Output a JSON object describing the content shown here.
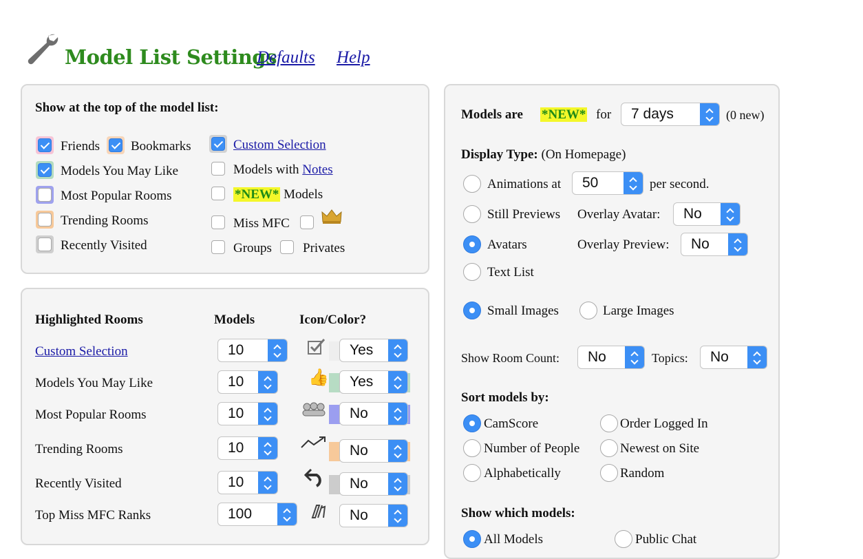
{
  "header": {
    "title": "Model List Settings",
    "defaults_link": "Defaults",
    "help_link": "Help"
  },
  "show_top": {
    "heading": "Show at the top of the model list:",
    "items": [
      {
        "label": "Friends",
        "checked": true
      },
      {
        "label": "Bookmarks",
        "checked": true
      },
      {
        "label": "Custom Selection",
        "checked": true
      },
      {
        "label": "Models You May Like",
        "checked": true
      },
      {
        "label": "Models with",
        "link": "Notes",
        "checked": false
      },
      {
        "label": "Most Popular Rooms",
        "checked": false
      },
      {
        "new_tag": "*NEW*",
        "label": "Models",
        "checked": false
      },
      {
        "label": "Trending Rooms",
        "checked": false
      },
      {
        "label": "Miss MFC",
        "checked": false
      },
      {
        "label": "Recently Visited",
        "checked": false
      },
      {
        "label": "Groups",
        "checked": false
      },
      {
        "label": "Privates",
        "checked": false
      }
    ]
  },
  "highlighted": {
    "heading": "Highlighted Rooms",
    "col_models": "Models",
    "col_icon": "Icon/Color?",
    "rows": [
      {
        "label": "Custom Selection",
        "models": "10",
        "icon": "checkbox-icon",
        "color": "#eeeeee",
        "value": "Yes"
      },
      {
        "label": "Models You May Like",
        "models": "10",
        "icon": "thumbs-up-icon",
        "color": "#b7dcc4",
        "value": "Yes"
      },
      {
        "label": "Most Popular Rooms",
        "models": "10",
        "icon": "crowd-icon",
        "color": "#9b9ef0",
        "value": "No"
      },
      {
        "label": "Trending Rooms",
        "models": "10",
        "icon": "trending-icon",
        "color": "#f7c99a",
        "value": "No"
      },
      {
        "label": "Recently Visited",
        "models": "10",
        "icon": "undo-arrow-icon",
        "color": "#cccccc",
        "value": "No"
      },
      {
        "label": "Top Miss MFC Ranks",
        "models": "100",
        "icon": "rank-icon",
        "color": "",
        "value": "No"
      }
    ]
  },
  "right": {
    "models_are": "Models are",
    "new_tag": "*NEW*",
    "for": "for",
    "new_period": "7 days",
    "new_count": "(0 new)",
    "display_type": "Display Type:",
    "display_hint": "(On Homepage)",
    "animations_label": "Animations at",
    "animations_rate": "50",
    "per_second": "per second.",
    "still_previews": "Still Previews",
    "overlay_avatar": "Overlay Avatar:",
    "overlay_avatar_val": "No",
    "avatars": "Avatars",
    "overlay_preview": "Overlay Preview:",
    "overlay_preview_val": "No",
    "text_list": "Text List",
    "small_images": "Small Images",
    "large_images": "Large Images",
    "show_room_count": "Show Room Count:",
    "room_count_val": "No",
    "topics": "Topics:",
    "topics_val": "No",
    "sort_heading": "Sort models by:",
    "sort": [
      "CamScore",
      "Order Logged In",
      "Number of People",
      "Newest on Site",
      "Alphabetically",
      "Random"
    ],
    "show_which": "Show which models:",
    "which": [
      "All Models",
      "Public Chat"
    ]
  },
  "colors": {
    "accent": "#3c8ff5",
    "title_green": "#2e8b1e",
    "link_blue": "#1a1aa6",
    "new_highlight": "#f4f72a"
  }
}
